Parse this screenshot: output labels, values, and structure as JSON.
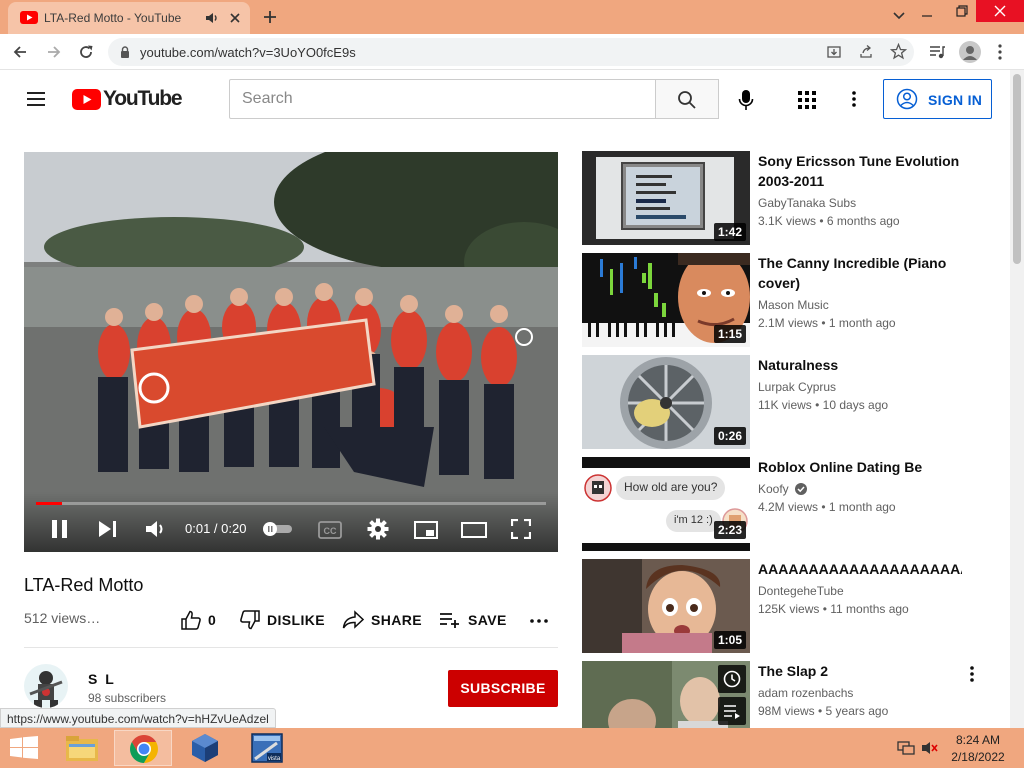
{
  "browser": {
    "tab_title": "LTA-Red Motto - YouTube",
    "url": "youtube.com/watch?v=3UoYO0fcE9s",
    "link_preview": "https://www.youtube.com/watch?v=hHZvUeAdzel"
  },
  "header": {
    "logo_text": "YouTube",
    "search_placeholder": "Search",
    "signin_label": "SIGN IN"
  },
  "player": {
    "time": "0:01 / 0:20",
    "progress": 0.05
  },
  "video": {
    "title": "LTA-Red Motto",
    "views": "512 views…",
    "likes": "0",
    "dislike_label": "DISLIKE",
    "share_label": "SHARE",
    "save_label": "SAVE"
  },
  "channel": {
    "name": "S L",
    "subscribers": "98 subscribers",
    "subscribe_label": "SUBSCRIBE"
  },
  "recommendations": [
    {
      "title": "Sony Ericsson Tune Evolution 2003-2011",
      "channel": "GabyTanaka Subs",
      "meta": "3.1K views • 6 months ago",
      "duration": "1:42"
    },
    {
      "title": "The Canny Incredible (Piano cover)",
      "channel": "Mason Music",
      "meta": "2.1M views • 1 month ago",
      "duration": "1:15"
    },
    {
      "title": "Naturalness",
      "channel": "Lurpak Cyprus",
      "meta": "11K views • 10 days ago",
      "duration": "0:26"
    },
    {
      "title": "Roblox Online Dating Be Like...",
      "channel": "Koofy",
      "meta": "4.2M views • 1 month ago",
      "duration": "2:23",
      "bubble1": "How old are you?",
      "bubble2": "i'm 12 :)"
    },
    {
      "title": "AAAAAAAAAAAAAAAAAAAAAA",
      "channel": "DontegeheTube",
      "meta": "125K views • 11 months ago",
      "duration": "1:05"
    },
    {
      "title": "The Slap 2",
      "channel": "adam rozenbachs",
      "meta": "98M views • 5 years ago"
    }
  ],
  "taskbar": {
    "time": "8:24 AM",
    "date": "2/18/2022"
  },
  "colors": {
    "chrome_accent": "#f0a77f",
    "youtube_red": "#ff0000",
    "subscribe_red": "#cc0000",
    "link_blue": "#065fd4"
  }
}
